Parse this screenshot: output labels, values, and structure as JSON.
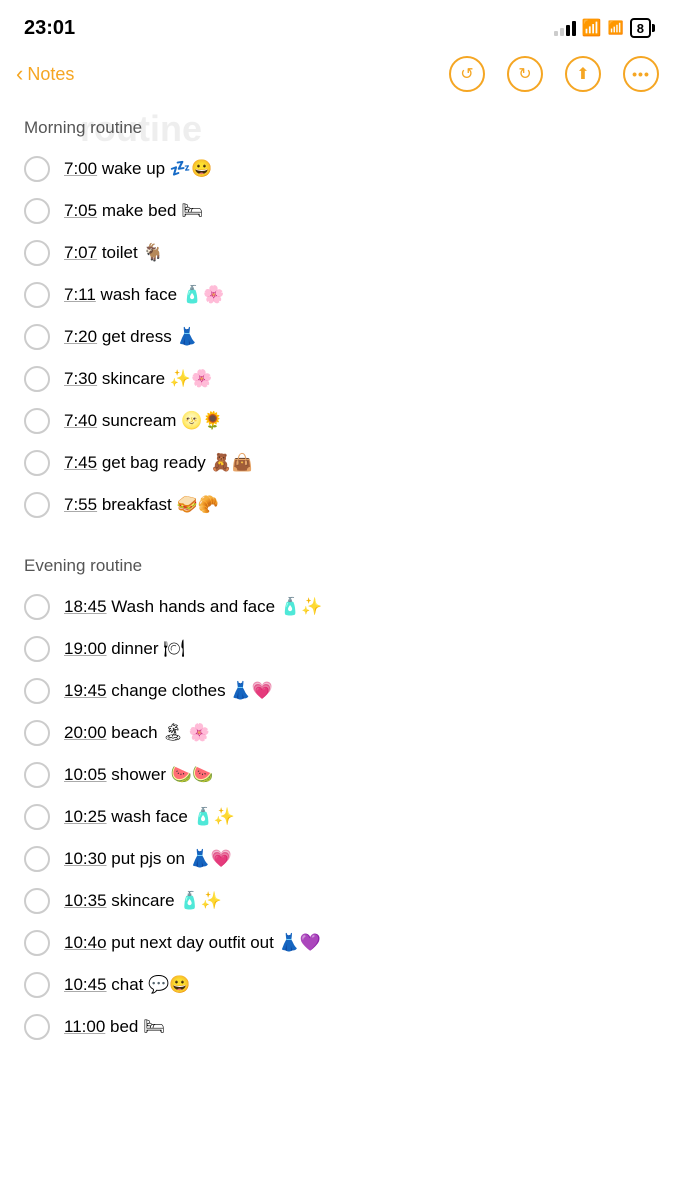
{
  "statusBar": {
    "time": "23:01",
    "batteryLevel": "8"
  },
  "nav": {
    "backLabel": "Notes",
    "watermark": "routine"
  },
  "sections": [
    {
      "title": "Morning routine",
      "items": [
        {
          "time": "7:00",
          "text": " wake up 💤😀"
        },
        {
          "time": "7:05",
          "text": " make bed 🛏"
        },
        {
          "time": "7:07",
          "text": " toilet 🐐"
        },
        {
          "time": "7:11",
          "text": " wash face 🧴🌸"
        },
        {
          "time": "7:20",
          "text": " get dress 👗"
        },
        {
          "time": "7:30",
          "text": " skincare ✨🌸"
        },
        {
          "time": "7:40",
          "text": " suncream 🌝🌻"
        },
        {
          "time": "7:45",
          "text": " get bag ready 🧸👜"
        },
        {
          "time": "7:55",
          "text": " breakfast 🥪🥐"
        }
      ]
    },
    {
      "title": "Evening routine",
      "items": [
        {
          "time": "18:45",
          "text": " Wash hands and face 🧴✨"
        },
        {
          "time": "19:00",
          "text": " dinner 🍽"
        },
        {
          "time": "19:45",
          "text": " change clothes 👗💗"
        },
        {
          "time": "20:00",
          "text": " beach 🏝 🌸"
        },
        {
          "time": "10:05",
          "text": " shower 🍉🍉"
        },
        {
          "time": "10:25",
          "text": " wash face 🧴✨"
        },
        {
          "time": "10:30",
          "text": " put pjs on 👗💗"
        },
        {
          "time": "10:35",
          "text": " skincare 🧴✨"
        },
        {
          "time": "10:4o",
          "text": " put next day outfit out 👗💜"
        },
        {
          "time": "10:45",
          "text": " chat 💬😀"
        },
        {
          "time": "11:00",
          "text": " bed 🛏"
        }
      ]
    }
  ]
}
